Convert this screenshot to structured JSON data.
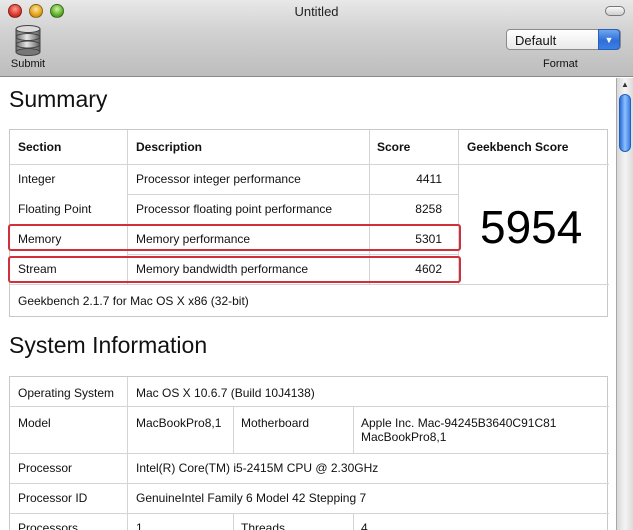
{
  "window": {
    "title": "Untitled"
  },
  "toolbar": {
    "submit_label": "Submit",
    "format_label": "Format",
    "format_value": "Default"
  },
  "summary": {
    "title": "Summary",
    "headers": {
      "section": "Section",
      "description": "Description",
      "score": "Score",
      "geekbench": "Geekbench Score"
    },
    "rows": [
      {
        "section": "Integer",
        "description": "Processor integer performance",
        "score": "4411"
      },
      {
        "section": "Floating Point",
        "description": "Processor floating point performance",
        "score": "8258"
      },
      {
        "section": "Memory",
        "description": "Memory performance",
        "score": "5301"
      },
      {
        "section": "Stream",
        "description": "Memory bandwidth performance",
        "score": "4602"
      }
    ],
    "geekbench_score": "5954",
    "footer": "Geekbench 2.1.7 for Mac OS X x86 (32-bit)"
  },
  "sysinfo": {
    "title": "System Information",
    "os_label": "Operating System",
    "os_value": "Mac OS X 10.6.7 (Build 10J4138)",
    "model_label": "Model",
    "model_value": "MacBookPro8,1",
    "motherboard_label": "Motherboard",
    "motherboard_value_1": "Apple Inc. Mac-94245B3640C91C81",
    "motherboard_value_2": "MacBookPro8,1",
    "processor_label": "Processor",
    "processor_value": "Intel(R) Core(TM) i5-2415M CPU @ 2.30GHz",
    "processor_id_label": "Processor ID",
    "processor_id_value": "GenuineIntel Family 6 Model 42 Stepping 7",
    "processors_label": "Processors",
    "processors_value": "1",
    "threads_label": "Threads",
    "threads_value": "4"
  },
  "colors": {
    "highlight": "#d0303a",
    "accent": "#3b80e6"
  }
}
